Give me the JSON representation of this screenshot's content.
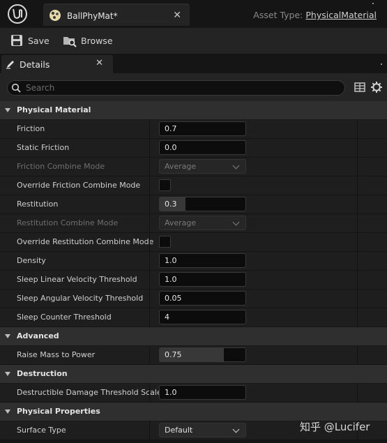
{
  "asset_tab": {
    "title": "BallPhyMat*",
    "close": "✕"
  },
  "asset_type": {
    "label": "Asset Type:",
    "value": "PhysicalMaterial"
  },
  "toolbar": {
    "save": "Save",
    "browse": "Browse"
  },
  "details_tab": {
    "label": "Details",
    "close": "✕"
  },
  "search": {
    "placeholder": "Search"
  },
  "categories": {
    "physical_material": {
      "label": "Physical Material",
      "rows": {
        "friction": {
          "name": "Friction",
          "value": "0.7"
        },
        "static_friction": {
          "name": "Static Friction",
          "value": "0.0"
        },
        "friction_combine_mode": {
          "name": "Friction Combine Mode",
          "value": "Average"
        },
        "override_friction_combine_mode": {
          "name": "Override Friction Combine Mode",
          "checked": false
        },
        "restitution": {
          "name": "Restitution",
          "value": "0.3",
          "fill_fraction": 0.3
        },
        "restitution_combine_mode": {
          "name": "Restitution Combine Mode",
          "value": "Average"
        },
        "override_restitution_combine_mode": {
          "name": "Override Restitution Combine Mode",
          "checked": false
        },
        "density": {
          "name": "Density",
          "value": "1.0"
        },
        "sleep_linear_velocity_threshold": {
          "name": "Sleep Linear Velocity Threshold",
          "value": "1.0"
        },
        "sleep_angular_velocity_threshold": {
          "name": "Sleep Angular Velocity Threshold",
          "value": "0.05"
        },
        "sleep_counter_threshold": {
          "name": "Sleep Counter Threshold",
          "value": "4"
        }
      }
    },
    "advanced": {
      "label": "Advanced",
      "rows": {
        "raise_mass_to_power": {
          "name": "Raise Mass to Power",
          "value": "0.75",
          "fill_fraction": 0.75
        }
      }
    },
    "destruction": {
      "label": "Destruction",
      "rows": {
        "destructible_damage_threshold_scale": {
          "name": "Destructible Damage Threshold Scale",
          "value": "1.0"
        }
      }
    },
    "physical_properties": {
      "label": "Physical Properties",
      "rows": {
        "surface_type": {
          "name": "Surface Type",
          "value": "Default"
        }
      }
    }
  },
  "watermark": "知乎 @Lucifer",
  "colors": {
    "panel": "#242424",
    "background": "#151515",
    "category": "#2f2f2f",
    "row": "#1e1e1e"
  }
}
